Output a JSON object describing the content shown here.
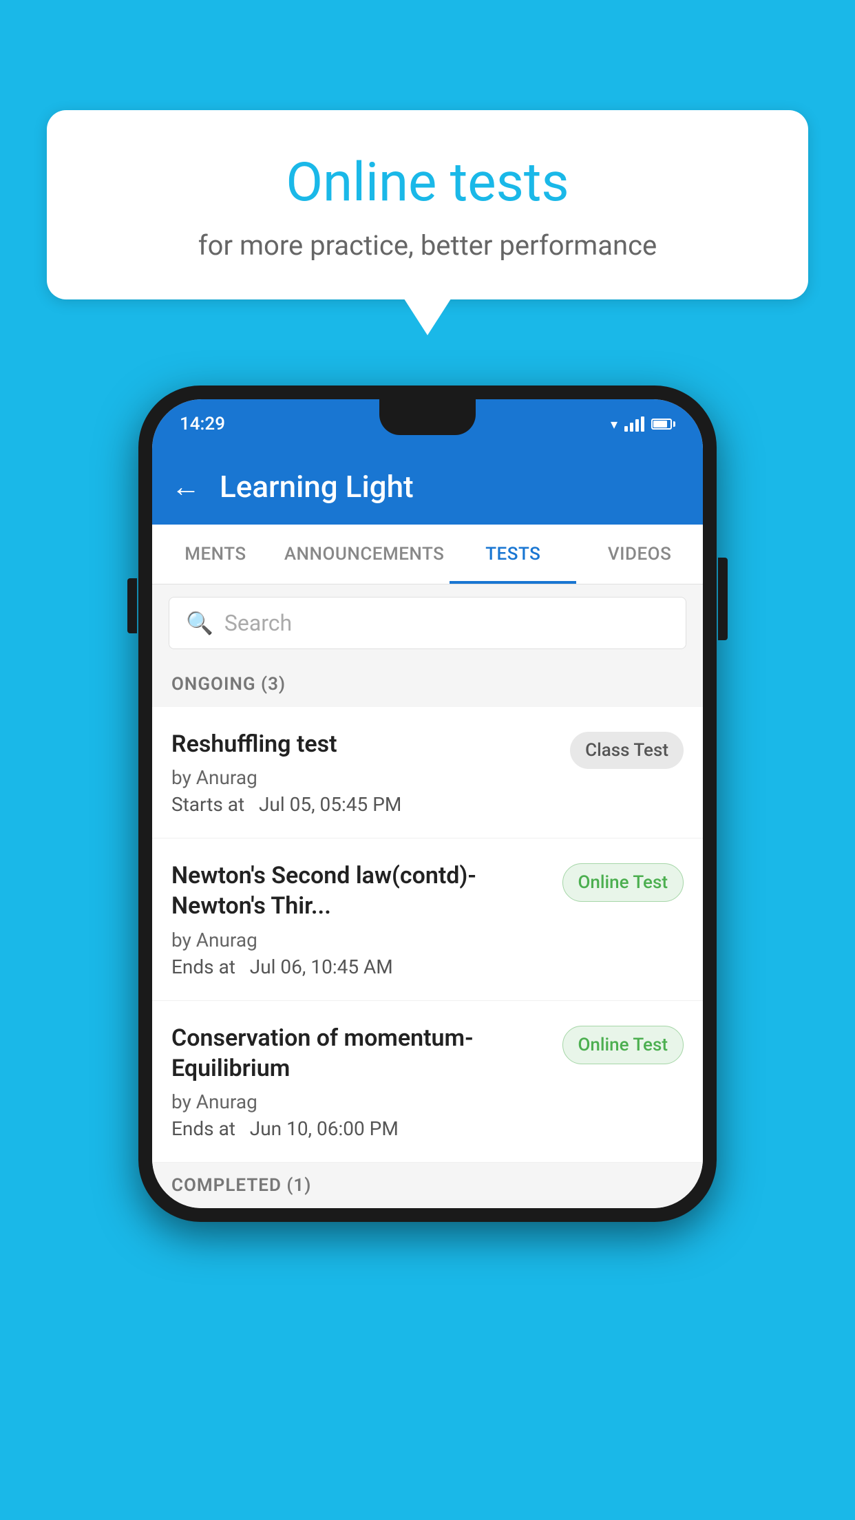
{
  "background_color": "#1ab8e8",
  "bubble": {
    "title": "Online tests",
    "subtitle": "for more practice, better performance"
  },
  "phone": {
    "status_bar": {
      "time": "14:29"
    },
    "app_bar": {
      "title": "Learning Light",
      "back_label": "←"
    },
    "tabs": [
      {
        "label": "MENTS",
        "active": false
      },
      {
        "label": "ANNOUNCEMENTS",
        "active": false
      },
      {
        "label": "TESTS",
        "active": true
      },
      {
        "label": "VIDEOS",
        "active": false
      }
    ],
    "search": {
      "placeholder": "Search"
    },
    "ongoing_section": {
      "label": "ONGOING (3)"
    },
    "tests": [
      {
        "name": "Reshuffling test",
        "author": "by Anurag",
        "time_label": "Starts at",
        "time": "Jul 05, 05:45 PM",
        "badge": "Class Test",
        "badge_type": "class"
      },
      {
        "name": "Newton's Second law(contd)-Newton's Thir...",
        "author": "by Anurag",
        "time_label": "Ends at",
        "time": "Jul 06, 10:45 AM",
        "badge": "Online Test",
        "badge_type": "online"
      },
      {
        "name": "Conservation of momentum-Equilibrium",
        "author": "by Anurag",
        "time_label": "Ends at",
        "time": "Jun 10, 06:00 PM",
        "badge": "Online Test",
        "badge_type": "online"
      }
    ],
    "completed_section": {
      "label": "COMPLETED (1)"
    }
  }
}
